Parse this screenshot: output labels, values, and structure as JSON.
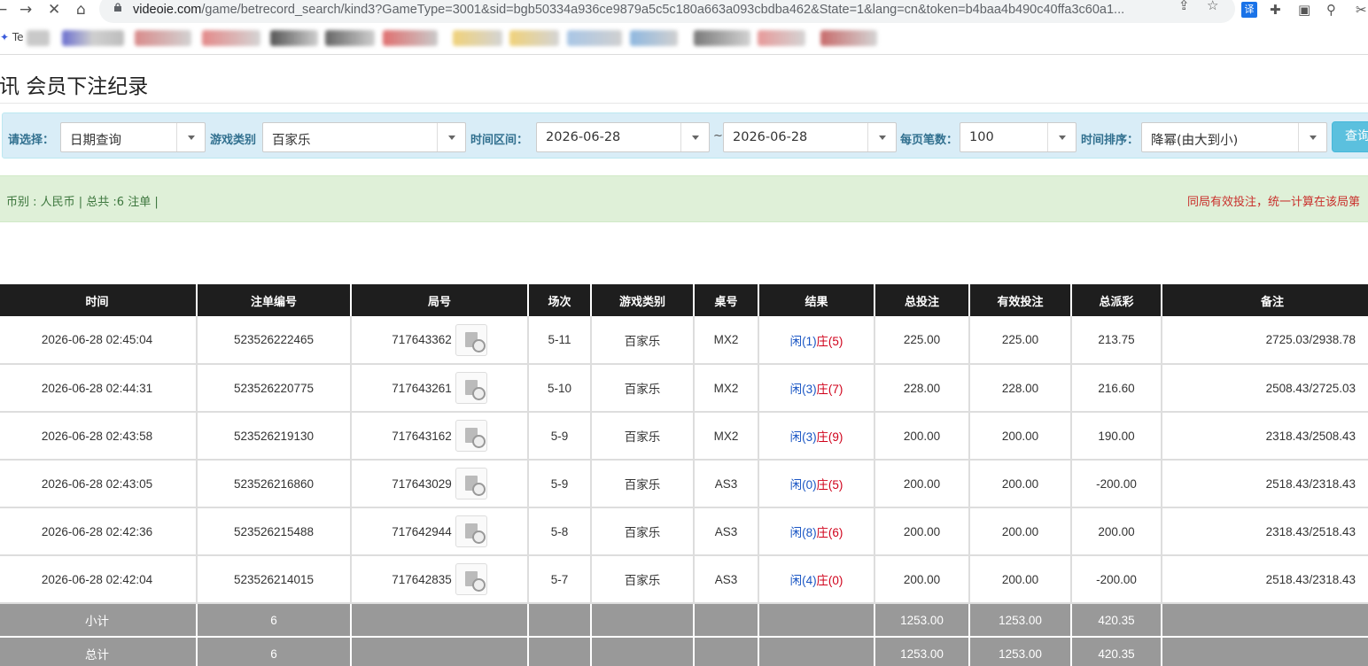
{
  "browser": {
    "url_host": "videoie.com",
    "url_path": "/game/betrecord_search/kind3?GameType=3001&sid=bgb50334a936ce9879a5c5c180a663a093cbdba462&State=1&lang=cn&token=b4baa4b490c40ffa3c60a1...",
    "bookmark_first": "Te",
    "translate_label": "译"
  },
  "page": {
    "title": "视讯 会员下注纪录"
  },
  "filters": {
    "select_label": "请选择：",
    "select_value": "日期查询",
    "game_type_label": "游戏类别",
    "game_type_value": "百家乐",
    "time_range_label": "时间区间：",
    "date_from": "2026-06-28",
    "tilde": "~",
    "date_to": "2026-06-28",
    "page_size_label": "每页笔数：",
    "page_size_value": "100",
    "sort_label": "时间排序：",
    "sort_value": "降幂(由大到小)",
    "query_button": "查询"
  },
  "info": {
    "left": "币别 : 人民币 | 总共 :6 注单 |",
    "right": "同局有效投注，统一计算在该局第"
  },
  "table": {
    "headers": [
      "时间",
      "注单编号",
      "局号",
      "场次",
      "游戏类别",
      "桌号",
      "结果",
      "总投注",
      "有效投注",
      "总派彩",
      "备注"
    ],
    "rows": [
      {
        "time": "2026-06-28 02:45:04",
        "order": "523526222465",
        "round": "717643362",
        "session": "5-11",
        "game": "百家乐",
        "table": "MX2",
        "player": "闲(1)",
        "banker": "庄(5)",
        "bet": "225.00",
        "valid": "225.00",
        "payout": "213.75",
        "payout_negative": false,
        "note": "2725.03/2938.78"
      },
      {
        "time": "2026-06-28 02:44:31",
        "order": "523526220775",
        "round": "717643261",
        "session": "5-10",
        "game": "百家乐",
        "table": "MX2",
        "player": "闲(3)",
        "banker": "庄(7)",
        "bet": "228.00",
        "valid": "228.00",
        "payout": "216.60",
        "payout_negative": false,
        "note": "2508.43/2725.03"
      },
      {
        "time": "2026-06-28 02:43:58",
        "order": "523526219130",
        "round": "717643162",
        "session": "5-9",
        "game": "百家乐",
        "table": "MX2",
        "player": "闲(3)",
        "banker": "庄(9)",
        "bet": "200.00",
        "valid": "200.00",
        "payout": "190.00",
        "payout_negative": false,
        "note": "2318.43/2508.43"
      },
      {
        "time": "2026-06-28 02:43:05",
        "order": "523526216860",
        "round": "717643029",
        "session": "5-9",
        "game": "百家乐",
        "table": "AS3",
        "player": "闲(0)",
        "banker": "庄(5)",
        "bet": "200.00",
        "valid": "200.00",
        "payout": "-200.00",
        "payout_negative": true,
        "note": "2518.43/2318.43"
      },
      {
        "time": "2026-06-28 02:42:36",
        "order": "523526215488",
        "round": "717642944",
        "session": "5-8",
        "game": "百家乐",
        "table": "AS3",
        "player": "闲(8)",
        "banker": "庄(6)",
        "bet": "200.00",
        "valid": "200.00",
        "payout": "200.00",
        "payout_negative": false,
        "note": "2318.43/2518.43"
      },
      {
        "time": "2026-06-28 02:42:04",
        "order": "523526214015",
        "round": "717642835",
        "session": "5-7",
        "game": "百家乐",
        "table": "AS3",
        "player": "闲(4)",
        "banker": "庄(0)",
        "bet": "200.00",
        "valid": "200.00",
        "payout": "-200.00",
        "payout_negative": true,
        "note": "2518.43/2318.43"
      }
    ],
    "subtotal": {
      "label": "小计",
      "count": "6",
      "bet": "1253.00",
      "valid": "1253.00",
      "payout": "420.35"
    },
    "total": {
      "label": "总计",
      "count": "6",
      "bet": "1253.00",
      "valid": "1253.00",
      "payout": "420.35"
    }
  },
  "colors": {
    "header_bg": "#1e1e1e",
    "filter_bg": "#d9edf7",
    "info_bg": "#dff0d8",
    "sum_bg": "#999999",
    "blue": "#1a56c4",
    "red": "#d0021b",
    "query_button": "#5bc0de"
  },
  "icons": [
    "back-icon",
    "forward-icon",
    "stop-icon",
    "home-icon",
    "lock-icon",
    "share-icon",
    "star-icon",
    "translate-icon",
    "extensions-icon",
    "sidebar-icon",
    "search-icon",
    "tools-icon",
    "video-replay-icon"
  ]
}
